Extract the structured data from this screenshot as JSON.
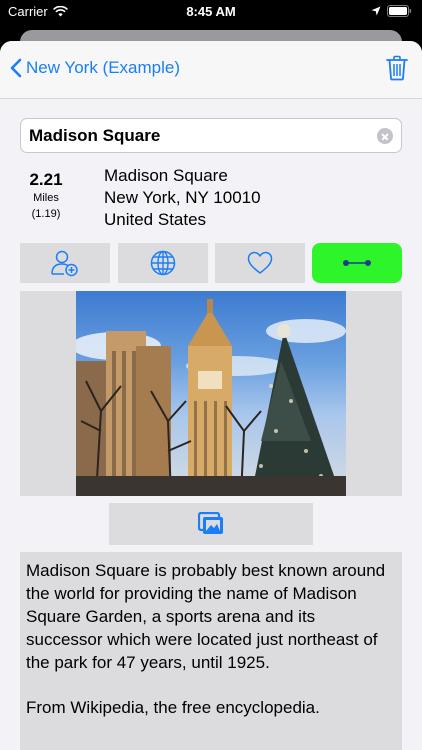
{
  "status": {
    "carrier": "Carrier",
    "time": "8:45 AM"
  },
  "nav": {
    "back_label": "New York (Example)"
  },
  "place": {
    "name": "Madison Square"
  },
  "distance": {
    "value": "2.21",
    "unit": "Miles",
    "alt": "(1.19)"
  },
  "address": {
    "line1": "Madison Square",
    "line2": "New York, NY 10010",
    "line3": "United States"
  },
  "description": {
    "paragraph1": "Madison Square is probably best known around the world for providing the name of Madison Square Garden, a sports arena and its successor which were located just northeast of the park for 47 years, until 1925.",
    "paragraph2": "From Wikipedia, the free encyclopedia."
  },
  "icons": {
    "add_contact": "add-contact-icon",
    "website": "globe-icon",
    "favorite": "heart-icon",
    "route": "route-icon",
    "gallery": "photo-gallery-icon",
    "trash": "trash-icon"
  },
  "colors": {
    "accent": "#1a7ef6",
    "route_button": "#2ef52a",
    "panel": "#dcdcdf"
  }
}
